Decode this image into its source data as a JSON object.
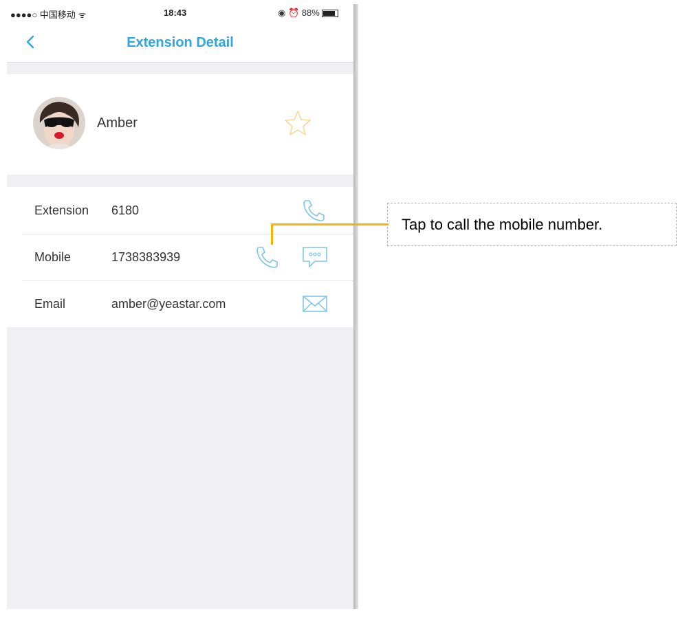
{
  "status_bar": {
    "carrier": "●●●●○ 中国移动 ᯤ",
    "time": "18:43",
    "right": "◉ ⏰ 88%"
  },
  "nav": {
    "title": "Extension Detail",
    "back_icon": "chevron-left-icon"
  },
  "contact": {
    "name": "Amber",
    "favorite_icon": "star-icon"
  },
  "details": [
    {
      "label": "Extension",
      "value": "6180",
      "icons": [
        "phone-icon"
      ]
    },
    {
      "label": "Mobile",
      "value": "1738383939",
      "icons": [
        "phone-icon",
        "chat-icon"
      ]
    },
    {
      "label": "Email",
      "value": "amber@yeastar.com",
      "icons": [
        "mail-icon"
      ]
    }
  ],
  "callout": {
    "text": "Tap to call the mobile number."
  },
  "colors": {
    "accent": "#2fa6dc",
    "icon_blue": "#7ec6e8",
    "star": "#f5d89a",
    "callout_border": "#f4b400"
  }
}
